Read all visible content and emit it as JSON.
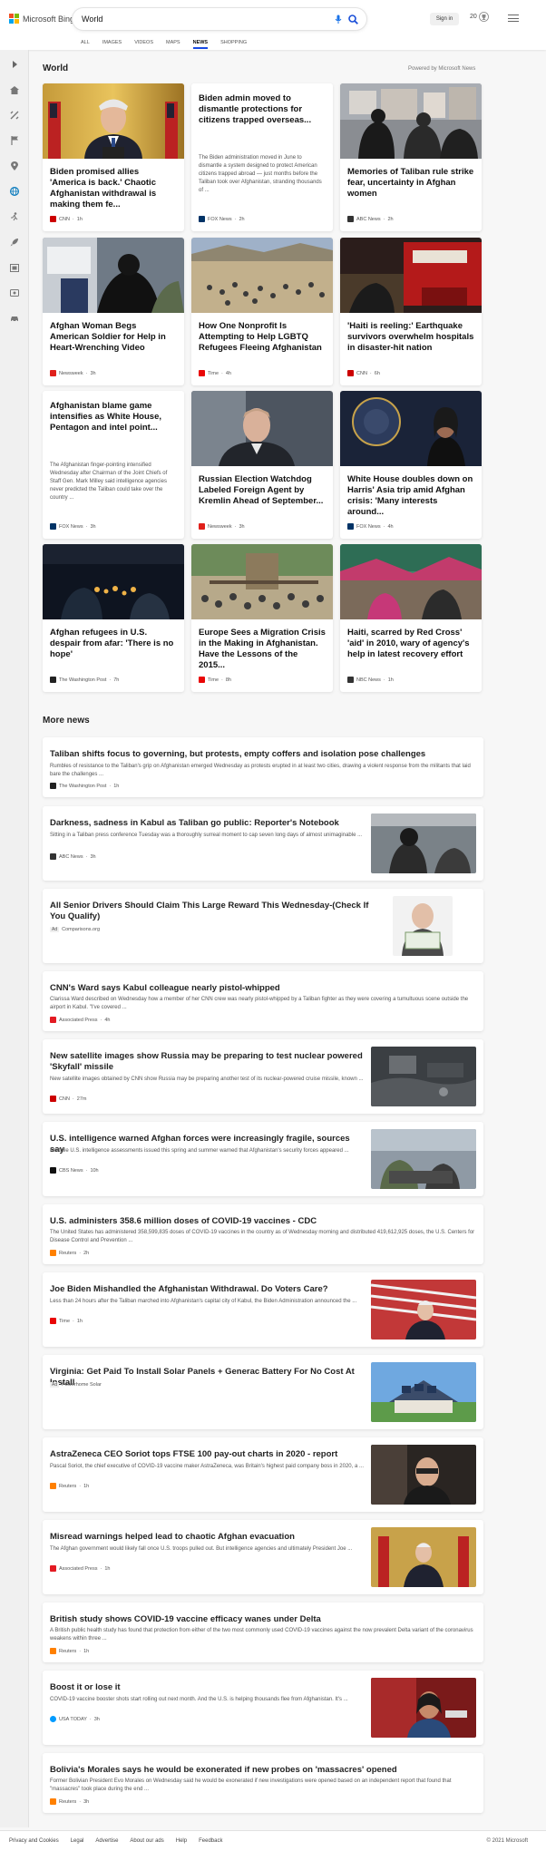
{
  "header": {
    "brand": "Microsoft Bing",
    "query": "World",
    "signin": "Sign in",
    "rewards_count": "20"
  },
  "tabs": [
    "ALL",
    "IMAGES",
    "VIDEOS",
    "MAPS",
    "NEWS",
    "SHOPPING"
  ],
  "active_tab": "NEWS",
  "section": {
    "title": "World",
    "powered_by": "Powered by Microsoft News"
  },
  "cards": [
    {
      "title": "Biden promised allies 'America is back.' Chaotic Afghanistan withdrawal is making them fe...",
      "source": "CNN",
      "time": "1h",
      "source_color": "#cc0000"
    },
    {
      "title": "Biden admin moved to dismantle protections for citizens trapped overseas...",
      "snippet": "The Biden administration moved in June to dismantle a system designed to protect American citizens trapped abroad — just months before the Taliban took over Afghanistan, stranding thousands of ...",
      "source": "FOX News",
      "time": "2h",
      "source_color": "#003366"
    },
    {
      "title": "Memories of Taliban rule strike fear, uncertainty in Afghan women",
      "source": "ABC News",
      "time": "2h",
      "source_color": "#333333"
    },
    {
      "title": "Afghan Woman Begs American Soldier for Help in Heart-Wrenching Video",
      "source": "Newsweek",
      "time": "3h",
      "source_color": "#e0201b"
    },
    {
      "title": "How One Nonprofit Is Attempting to Help LGBTQ Refugees Fleeing Afghanistan",
      "source": "Time",
      "time": "4h",
      "source_color": "#e90606"
    },
    {
      "title": "'Haiti is reeling:' Earthquake survivors overwhelm hospitals in disaster-hit nation",
      "source": "CNN",
      "time": "6h",
      "source_color": "#cc0000"
    },
    {
      "title": "Afghanistan blame game intensifies as White House, Pentagon and intel point...",
      "snippet": "The Afghanistan finger-pointing intensified Wednesday after Chairman of the Joint Chiefs of Staff Gen. Mark Milley said intelligence agencies never predicted the Taliban could take over the country ...",
      "source": "FOX News",
      "time": "3h",
      "source_color": "#003366"
    },
    {
      "title": "Russian Election Watchdog Labeled Foreign Agent by Kremlin Ahead of September...",
      "source": "Newsweek",
      "time": "3h",
      "source_color": "#e0201b"
    },
    {
      "title": "White House doubles down on Harris' Asia trip amid Afghan crisis: 'Many interests around...",
      "source": "FOX News",
      "time": "4h",
      "source_color": "#003366"
    },
    {
      "title": "Afghan refugees in U.S. despair from afar: 'There is no hope'",
      "source": "The Washington Post",
      "time": "7h",
      "source_color": "#222222"
    },
    {
      "title": "Europe Sees a Migration Crisis in the Making in Afghanistan. Have the Lessons of the 2015...",
      "source": "Time",
      "time": "8h",
      "source_color": "#e90606"
    },
    {
      "title": "Haiti, scarred by Red Cross' 'aid' in 2010, wary of agency's help in latest recovery effort",
      "source": "NBC News",
      "time": "1h",
      "source_color": "#333333"
    }
  ],
  "more_news": {
    "title": "More news",
    "items": [
      {
        "title": "Taliban shifts focus to governing, but protests, empty coffers and isolation pose challenges",
        "snippet": "Rumbles of resistance to the Taliban's grip on Afghanistan emerged Wednesday as protests erupted in at least two cities, drawing a violent response from the militants that laid bare the challenges ...",
        "source": "The Washington Post",
        "time": "1h",
        "source_color": "#222222"
      },
      {
        "title": "Darkness, sadness in Kabul as Taliban go public: Reporter's Notebook",
        "snippet": "Sitting in a Taliban press conference Tuesday was a thoroughly surreal moment to cap seven long days of almost unimaginable ...",
        "source": "ABC News",
        "time": "3h",
        "source_color": "#333333"
      },
      {
        "title": "All Senior Drivers Should Claim This Large Reward This Wednesday-(Check If You Qualify)",
        "ad_label": "Ad",
        "source": "Comparisons.org"
      },
      {
        "title": "CNN's Ward says Kabul colleague nearly pistol-whipped",
        "snippet": "Clarissa Ward described on Wednesday how a member of her CNN crew was nearly pistol-whipped by a Taliban fighter as they were covering a tumultuous scene outside the airport in Kabul. \"I've covered ...",
        "source": "Associated Press",
        "time": "4h",
        "source_color": "#e31b23"
      },
      {
        "title": "New satellite images show Russia may be preparing to test nuclear powered 'Skyfall' missile",
        "snippet": "New satellite images obtained by CNN show Russia may be preparing another test of its nuclear-powered cruise missile, known ...",
        "source": "CNN",
        "time": "27m",
        "source_color": "#cc0000"
      },
      {
        "title": "U.S. intelligence warned Afghan forces were increasingly fragile, sources say",
        "snippet": "Multiple U.S. intelligence assessments issued this spring and summer warned that Afghanistan's security forces appeared ...",
        "source": "CBS News",
        "time": "10h",
        "source_color": "#111111"
      },
      {
        "title": "U.S. administers 358.6 million doses of COVID-19 vaccines - CDC",
        "snippet": "The United States has administered 358,599,835 doses of COVID-19 vaccines in the country as of Wednesday morning and distributed 419,612,925 doses, the U.S. Centers for Disease Control and Prevention ...",
        "source": "Reuters",
        "time": "2h",
        "source_color": "#ff8000"
      },
      {
        "title": "Joe Biden Mishandled the Afghanistan Withdrawal. Do Voters Care?",
        "snippet": "Less than 24 hours after the Taliban marched into Afghanistan's capital city of Kabul, the Biden Administration announced the ...",
        "source": "Time",
        "time": "1h",
        "source_color": "#e90606"
      },
      {
        "title": "Virginia: Get Paid To Install Solar Panels + Generac Battery For No Cost At Install",
        "ad_label": "Ad",
        "source": "Powerhome Solar"
      },
      {
        "title": "AstraZeneca CEO Soriot tops FTSE 100 pay-out charts in 2020 - report",
        "snippet": "Pascal Soriot, the chief executive of COVID-19 vaccine maker AstraZeneca, was Britain's highest paid company boss in 2020, a ...",
        "source": "Reuters",
        "time": "1h",
        "source_color": "#ff8000"
      },
      {
        "title": "Misread warnings helped lead to chaotic Afghan evacuation",
        "snippet": "The Afghan government would likely fall once U.S. troops pulled out. But intelligence agencies and ultimately President Joe ...",
        "source": "Associated Press",
        "time": "1h",
        "source_color": "#e31b23"
      },
      {
        "title": "British study shows COVID-19 vaccine efficacy wanes under Delta",
        "snippet": "A British public health study has found that protection from either of the two most commonly used COVID-19 vaccines against the now prevalent Delta variant of the coronavirus weakens within three ...",
        "source": "Reuters",
        "time": "1h",
        "source_color": "#ff8000"
      },
      {
        "title": "Boost it or lose it",
        "snippet": "COVID-19 vaccine booster shots start rolling out next month. And the U.S. is helping thousands flee from Afghanistan. It's ...",
        "source": "USA TODAY",
        "time": "3h",
        "source_color": "#009bff"
      },
      {
        "title": "Bolivia's Morales says he would be exonerated if new probes on 'massacres' opened",
        "snippet": "Former Bolivian President Evo Morales on Wednesday said he would be exonerated if new investigations were opened based on an independent report that found that \"massacres\" took place during the end ...",
        "source": "Reuters",
        "time": "3h",
        "source_color": "#ff8000"
      }
    ]
  },
  "footer": {
    "links": [
      "Privacy and Cookies",
      "Legal",
      "Advertise",
      "About our ads",
      "Help",
      "Feedback"
    ],
    "copyright": "© 2021 Microsoft"
  }
}
